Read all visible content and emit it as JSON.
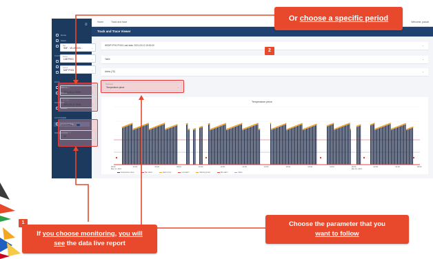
{
  "app": {
    "window_title": "Track and Trace Viewer",
    "topbar": {
      "home": "Home",
      "breadcrumb": "Track and trace",
      "user": "Welcome, pascal"
    },
    "sidebar": {
      "items": [
        {
          "label": "Home",
          "head": false
        },
        {
          "label": "Users",
          "head": false
        },
        {
          "label": "Reports",
          "head": false
        },
        {
          "label": "CONFIGURATION",
          "head": true
        },
        {
          "label": "Sites",
          "head": false
        },
        {
          "label": "Devices",
          "head": false
        },
        {
          "label": "Sensors",
          "head": false
        },
        {
          "label": "DATA",
          "head": true
        },
        {
          "label": "Alarms",
          "head": false
        },
        {
          "label": "Events",
          "head": false
        },
        {
          "label": "SUPPORT",
          "head": true
        },
        {
          "label": "Guides",
          "head": false
        },
        {
          "label": "CUSTOMER",
          "head": true
        },
        {
          "label": "Track & Trace",
          "head": false,
          "active": true
        },
        {
          "label": "OPERATIONS",
          "head": true
        }
      ]
    },
    "filters": {
      "site": {
        "label": "Site",
        "value": "SNF - VILLEBON..."
      },
      "device": {
        "label": "Device",
        "value": "LAB PH01"
      },
      "sensor": {
        "label": "Sensor",
        "value": "DAP PH01"
      },
      "date_from": {
        "label": "Start date",
        "value": "2021-03-11 15:00"
      },
      "date_to": {
        "label": "End date",
        "value": "2021-03-12 15:00"
      },
      "monitoring": {
        "label": "Monitoring",
        "value": "On"
      },
      "refresh": {
        "label": "Refresh (s)",
        "value": "30"
      }
    },
    "device_bar": "WSDPI PH1 PH01 Last data: 2021-03-12 15:00:00",
    "table_bar": "Table",
    "alerts_bar": "Alerts (75)",
    "parameter": {
      "label": "Parameter",
      "value": "Temperature piece"
    },
    "chart_data": {
      "type": "area",
      "title": "Temperature piece",
      "x_ticks": [
        "02:00\nMar 11, 2021",
        "04:00",
        "06:00",
        "08:00",
        "10:00",
        "12:00",
        "14:00",
        "16:00",
        "18:00",
        "20:00",
        "22:00",
        "00:00\nMar 12, 2021",
        "02:00",
        "04:00",
        "06:00"
      ],
      "legend": [
        "Temperature piece",
        "Max alarm",
        "Alarm (min)",
        "Low alarm",
        "Warning (max)",
        "Min alarm",
        "Mean"
      ]
    }
  },
  "callouts": {
    "period": {
      "prefix": "Or ",
      "underlined": "choose a specific period",
      "badge": "2"
    },
    "monitoring": {
      "text_1": "If ",
      "underlined_1": "you choose monitoring",
      "text_2": ", ",
      "underlined_2": "you will",
      "line2_under": "see",
      "line2_rest": " the data live report",
      "badge": "1"
    },
    "parameter": {
      "line1": "Choose the parameter that you",
      "line2": "want to follow"
    }
  },
  "colors": {
    "callout": "#e8492d",
    "sidebar": "#1c3a5e",
    "titlebar": "#1f4270",
    "bars": "#2f3a55",
    "dots": "#f0a020",
    "threshold": "#e03a3a"
  }
}
